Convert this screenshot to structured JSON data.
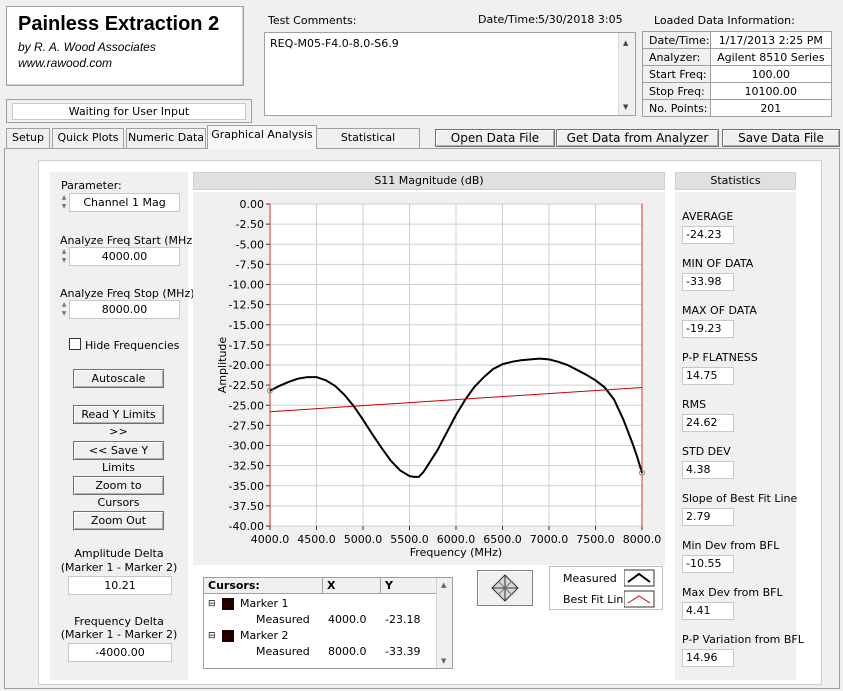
{
  "app": {
    "title": "Painless Extraction 2",
    "subtitle1": "by R. A. Wood Associates",
    "subtitle2": "www.rawood.com",
    "status": "Waiting for User Input"
  },
  "comments": {
    "label": "Test Comments:",
    "text": "REQ-M05-F4.0-8.0-S6.9",
    "datetime_label": "Date/Time:",
    "datetime_value": "5/30/2018  3:05"
  },
  "loaded": {
    "label": "Loaded Data Information:",
    "rows": [
      {
        "k": "Date/Time:",
        "v": "1/17/2013 2:25 PM"
      },
      {
        "k": "Analyzer:",
        "v": "Agilent 8510 Series"
      },
      {
        "k": "Start Freq:",
        "v": "100.00"
      },
      {
        "k": "Stop Freq:",
        "v": "10100.00"
      },
      {
        "k": "No. Points:",
        "v": "201"
      }
    ]
  },
  "tabs": [
    "Setup",
    "Quick Plots",
    "Numeric Data",
    "Graphical Analysis",
    "Statistical Analysis"
  ],
  "actions": {
    "open": "Open Data File",
    "get": "Get Data from Analyzer",
    "save": "Save Data File"
  },
  "left": {
    "parameter_label": "Parameter:",
    "parameter_value": "Channel 1 Mag",
    "start_label": "Analyze Freq Start (MHz)",
    "start_value": "4000.00",
    "stop_label": "Analyze Freq Stop (MHz)",
    "stop_value": "8000.00",
    "hide_freq": "Hide Frequencies",
    "autoscale": "Autoscale",
    "read_y": "Read Y Limits >>",
    "save_y": "<< Save Y Limits",
    "zoom_cursors": "Zoom to Cursors",
    "zoom_out": "Zoom Out",
    "amp_delta_label1": "Amplitude Delta",
    "amp_delta_label2": "(Marker 1 - Marker 2)",
    "amp_delta_value": "10.21",
    "freq_delta_label1": "Frequency Delta",
    "freq_delta_label2": "(Marker 1 - Marker 2)",
    "freq_delta_value": "-4000.00"
  },
  "cursors": {
    "header": [
      "Cursors:",
      "X",
      "Y"
    ],
    "marker1": "Marker 1",
    "marker1_meas": "Measured",
    "marker1_x": "4000.0",
    "marker1_y": "-23.18",
    "marker2": "Marker 2",
    "marker2_meas": "Measured",
    "marker2_x": "8000.0",
    "marker2_y": "-33.39"
  },
  "legend": {
    "measured": "Measured",
    "bfl": "Best Fit Line"
  },
  "stats": {
    "title": "Statistics",
    "items": [
      {
        "label": "AVERAGE",
        "value": "-24.23"
      },
      {
        "label": "MIN OF DATA",
        "value": "-33.98"
      },
      {
        "label": "MAX OF DATA",
        "value": "-19.23"
      },
      {
        "label": "P-P FLATNESS",
        "value": "14.75"
      },
      {
        "label": "RMS",
        "value": "24.62"
      },
      {
        "label": "STD DEV",
        "value": "4.38"
      },
      {
        "label": "Slope of Best Fit Line",
        "value": "2.79"
      },
      {
        "label": "Min Dev from BFL",
        "value": "-10.55"
      },
      {
        "label": "Max Dev from BFL",
        "value": "4.41"
      },
      {
        "label": "P-P Variation from BFL",
        "value": "14.96"
      }
    ]
  },
  "colors": {
    "measured": "#000000",
    "bfl": "#cc0000",
    "grid": "#cfcfcf"
  },
  "chart_data": {
    "type": "line",
    "title": "S11 Magnitude (dB)",
    "xlabel": "Frequency (MHz)",
    "ylabel": "Amplitude",
    "xlim": [
      4000,
      8000
    ],
    "ylim": [
      -40,
      0
    ],
    "xticks": [
      "4000.0",
      "4500.0",
      "5000.0",
      "5500.0",
      "6000.0",
      "6500.0",
      "7000.0",
      "7500.0",
      "8000.0"
    ],
    "yticks": [
      "0.00",
      "-2.50",
      "-5.00",
      "-7.50",
      "-10.00",
      "-12.50",
      "-15.00",
      "-17.50",
      "-20.00",
      "-22.50",
      "-25.00",
      "-27.50",
      "-30.00",
      "-32.50",
      "-35.00",
      "-37.50",
      "-40.00"
    ],
    "grid": true,
    "series": [
      {
        "name": "Measured",
        "x": [
          4000,
          4100,
          4200,
          4300,
          4400,
          4500,
          4600,
          4700,
          4800,
          4900,
          5000,
          5100,
          5200,
          5300,
          5400,
          5500,
          5550,
          5600,
          5650,
          5700,
          5800,
          5900,
          6000,
          6100,
          6200,
          6300,
          6400,
          6500,
          6600,
          6700,
          6800,
          6900,
          7000,
          7100,
          7200,
          7300,
          7400,
          7500,
          7600,
          7700,
          7800,
          7900,
          7950,
          8000
        ],
        "y": [
          -23.2,
          -22.6,
          -22.1,
          -21.7,
          -21.5,
          -21.5,
          -21.9,
          -22.6,
          -23.7,
          -25.1,
          -26.8,
          -28.6,
          -30.3,
          -31.9,
          -33.1,
          -33.8,
          -33.9,
          -33.9,
          -33.3,
          -32.4,
          -30.6,
          -28.4,
          -26.2,
          -24.3,
          -22.7,
          -21.5,
          -20.5,
          -19.9,
          -19.6,
          -19.4,
          -19.3,
          -19.2,
          -19.3,
          -19.6,
          -20.0,
          -20.6,
          -21.2,
          -21.9,
          -22.8,
          -24.3,
          -26.8,
          -29.8,
          -31.5,
          -33.4
        ]
      },
      {
        "name": "Best Fit Line",
        "x": [
          4000,
          8000
        ],
        "y": [
          -25.8,
          -22.8
        ]
      }
    ]
  }
}
